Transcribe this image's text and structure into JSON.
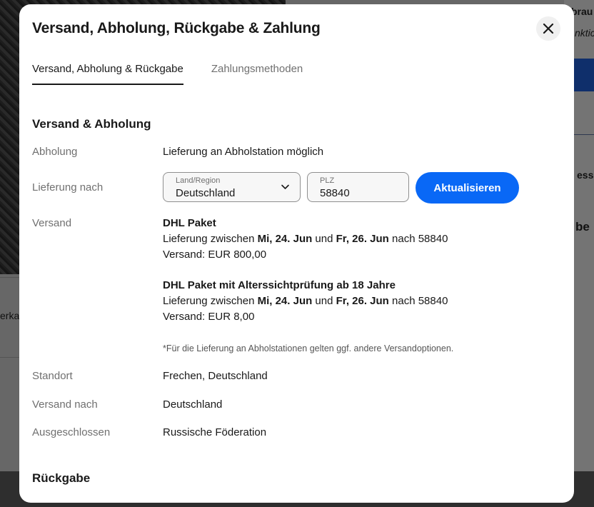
{
  "background": {
    "snippets": [
      "brau",
      "nktic",
      "essi",
      "be",
      "erka"
    ]
  },
  "dialog": {
    "title": "Versand, Abholung, Rückgabe & Zahlung",
    "close_icon": "close-icon",
    "tabs": [
      {
        "label": "Versand, Abholung & Rückgabe",
        "active": true
      },
      {
        "label": "Zahlungsmethoden",
        "active": false
      }
    ],
    "section_shipping": {
      "title": "Versand & Abholung",
      "pickup_label": "Abholung",
      "pickup_value": "Lieferung an Abholstation möglich",
      "delivery_label": "Lieferung nach",
      "country_field": {
        "label": "Land/Region",
        "value": "Deutschland"
      },
      "zip_field": {
        "label": "PLZ",
        "value": "58840"
      },
      "update_button": "Aktualisieren",
      "shipping_label": "Versand",
      "options": [
        {
          "name": "DHL Paket",
          "line_prefix": "Lieferung zwischen ",
          "date_from": "Mi, 24. Jun",
          "line_mid": " und ",
          "date_to": "Fr, 26. Jun",
          "line_suffix": " nach 58840",
          "cost": "Versand: EUR 800,00"
        },
        {
          "name": "DHL Paket mit Alterssichtprüfung ab 18 Jahre",
          "line_prefix": "Lieferung zwischen ",
          "date_from": "Mi, 24. Jun",
          "line_mid": " und ",
          "date_to": "Fr, 26. Jun",
          "line_suffix": " nach 58840",
          "cost": "Versand: EUR 8,00"
        }
      ],
      "note": "*Für die Lieferung an Abholstationen gelten ggf. andere Versandoptionen.",
      "location_label": "Standort",
      "location_value": "Frechen, Deutschland",
      "ships_to_label": "Versand nach",
      "ships_to_value": "Deutschland",
      "excluded_label": "Ausgeschlossen",
      "excluded_value": "Russische Föderation"
    },
    "section_returns": {
      "title": "Rückgabe"
    }
  },
  "colors": {
    "accent": "#0968f6",
    "text": "#191919",
    "muted": "#707070"
  }
}
